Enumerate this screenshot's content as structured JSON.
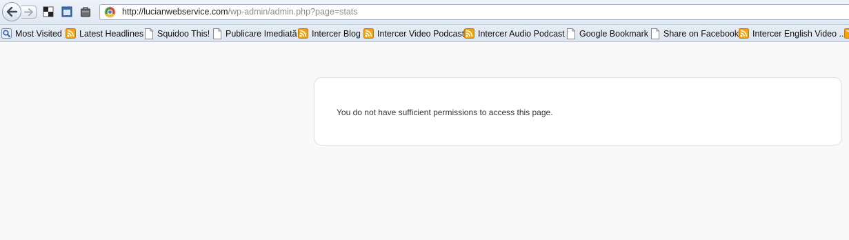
{
  "browser": {
    "url_host": "http://lucianwebservice.com",
    "url_path": "/wp-admin/admin.php?page=stats"
  },
  "bookmarks": [
    {
      "label": "Most Visited",
      "icon": "most-visited-icon"
    },
    {
      "label": "Latest Headlines",
      "icon": "rss-feed-icon"
    },
    {
      "label": "Squidoo This!",
      "icon": "page-icon"
    },
    {
      "label": "Publicare Imediată",
      "icon": "page-icon"
    },
    {
      "label": "Intercer Blog",
      "icon": "rss-feed-icon"
    },
    {
      "label": "Intercer Video Podcast",
      "icon": "rss-feed-icon"
    },
    {
      "label": "Intercer Audio Podcast",
      "icon": "rss-feed-icon"
    },
    {
      "label": "Google Bookmark",
      "icon": "page-icon"
    },
    {
      "label": "Share on Facebook",
      "icon": "page-icon"
    },
    {
      "label": "Intercer English Video ...",
      "icon": "rss-feed-icon"
    }
  ],
  "page": {
    "message": "You do not have sufficient permissions to access this page."
  },
  "colors": {
    "rss": "#f2a40a",
    "page_background": "#f9f9f9"
  }
}
